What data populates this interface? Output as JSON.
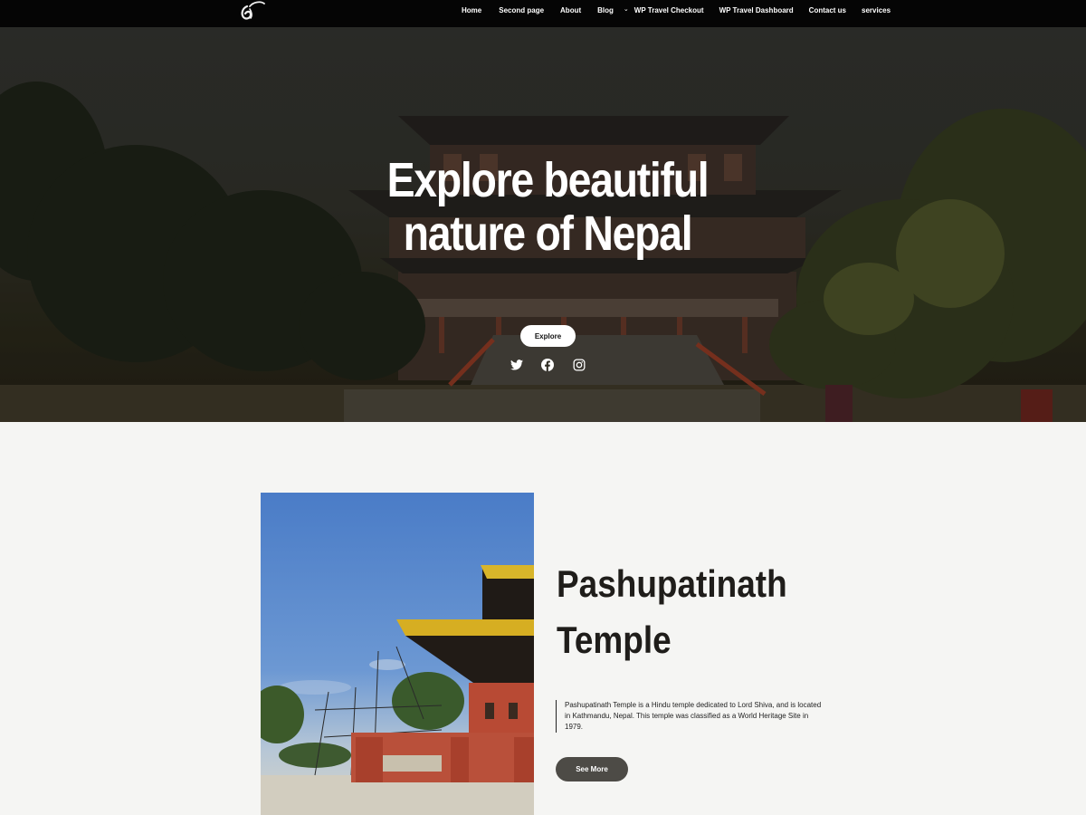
{
  "nav": {
    "items": [
      {
        "label": "Home"
      },
      {
        "label": "Second page"
      },
      {
        "label": "About"
      },
      {
        "label": "Blog"
      },
      {
        "label": "WP Travel Checkout"
      },
      {
        "label": "WP Travel Dashboard"
      },
      {
        "label": "Contact us"
      },
      {
        "label": "services"
      }
    ],
    "blog_dropdown_icon": "chevron-down-icon",
    "logo_icon": "logo-icon"
  },
  "hero": {
    "title_line1": "Explore beautiful",
    "title_line2": "nature of Nepal",
    "button_label": "Explore",
    "social_icons": [
      "twitter-icon",
      "facebook-icon",
      "instagram-icon"
    ]
  },
  "feature": {
    "title_line1": "Pashupatinath",
    "title_line2": "Temple",
    "description": "Pashupatinath Temple is a Hindu temple dedicated to Lord Shiva, and is located in Kathmandu, Nepal. This temple was classified as a World Heritage Site in 1979.",
    "button_label": "See More"
  },
  "colors": {
    "topbar": "#050505",
    "page_background": "#f5f5f3",
    "see_more_button": "#4d4b46",
    "explore_button": "#ffffff"
  }
}
